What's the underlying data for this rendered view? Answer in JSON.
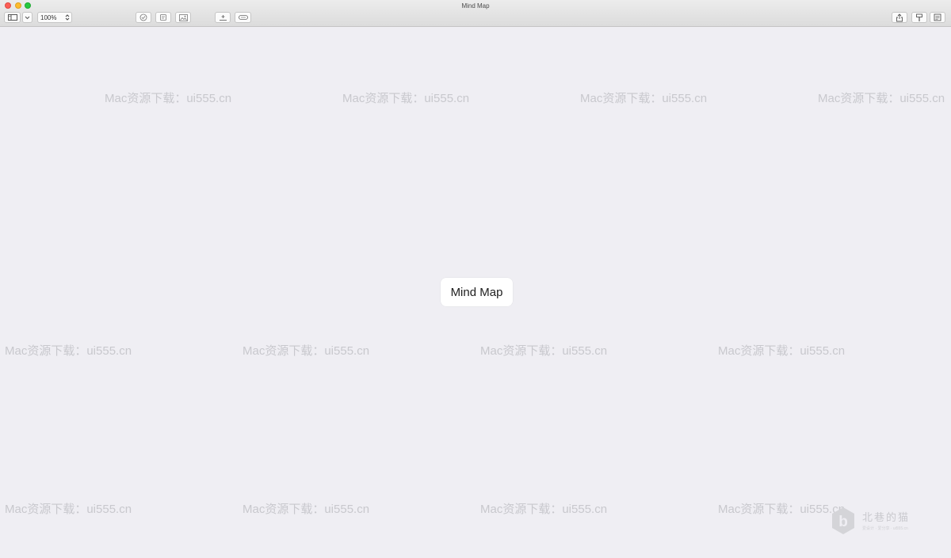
{
  "window": {
    "title": "Mind Map"
  },
  "toolbar": {
    "zoom_value": "100%"
  },
  "canvas": {
    "central_node": "Mind Map"
  },
  "watermark": {
    "text": "Mac资源下载：ui555.cn"
  },
  "logo": {
    "name": "北巷的猫",
    "sub": "爱设计 · 爱分享 · ui555.cn"
  },
  "colors": {
    "background": "#efeef3",
    "node": "#ffffff",
    "watermark": "#c8c8cd"
  }
}
